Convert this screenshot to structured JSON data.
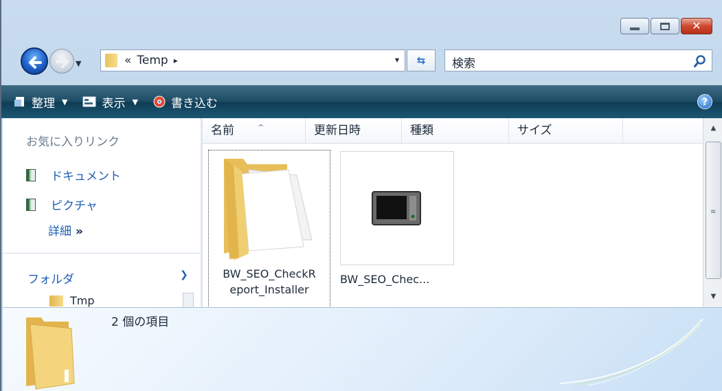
{
  "address_bar": {
    "chevron": "«",
    "path": "Temp",
    "segment_arrow": "▸",
    "dropdown": "▾"
  },
  "search": {
    "label": "検索"
  },
  "toolbar": {
    "organize": "整理",
    "views": "表示",
    "burn": "書き込む",
    "help": "?"
  },
  "nav_pane": {
    "favorites_title": "お気に入りリンク",
    "favorites": [
      {
        "label": "ドキュメント",
        "icon": "documents-icon"
      },
      {
        "label": "ピクチャ",
        "icon": "pictures-icon"
      }
    ],
    "more_label": "詳細",
    "more_chevrons": "»",
    "folders_label": "フォルダ",
    "tree_items": [
      {
        "label": "Tmp"
      }
    ]
  },
  "columns": [
    {
      "label": "名前"
    },
    {
      "label": "更新日時"
    },
    {
      "label": "種類"
    },
    {
      "label": "サイズ"
    }
  ],
  "files": [
    {
      "name_line1": "BW_SEO_CheckR",
      "name_line2": "eport_Installer",
      "icon": "folder-icon"
    },
    {
      "name": "BW_SEO_Chec...",
      "icon": "application-window-icon"
    }
  ],
  "details_pane": {
    "item_count": "2 個の項目"
  },
  "colors": {
    "toolbar": "#1d4d66",
    "frame": "#b5cde6",
    "link": "#1f5fb5",
    "close_button": "#d0492f"
  }
}
